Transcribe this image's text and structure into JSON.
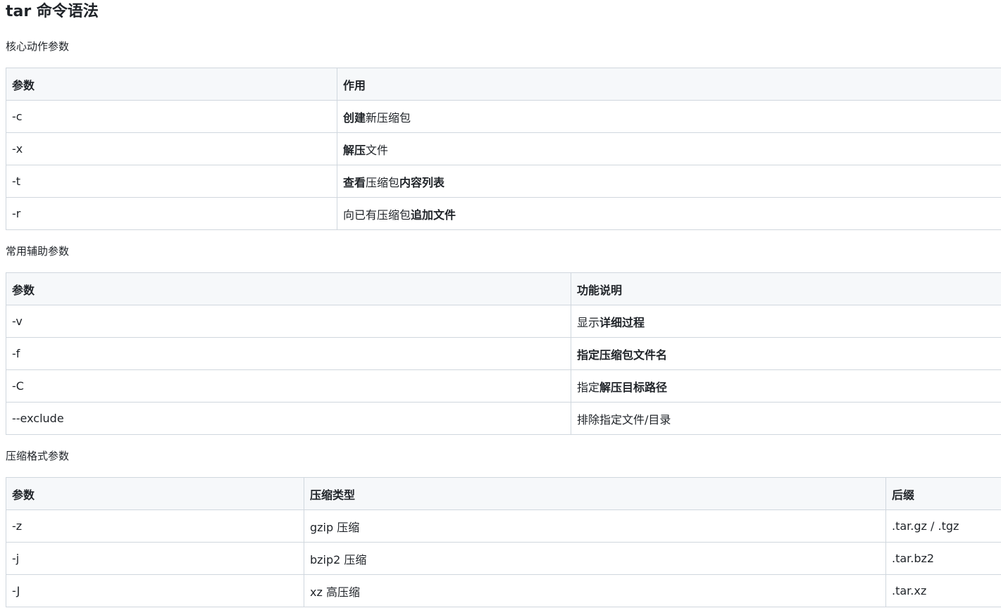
{
  "title": "tar 命令语法",
  "sections": [
    {
      "label": "核心动作参数",
      "headers": [
        "参数",
        "作用"
      ],
      "rows": [
        [
          [
            "-c"
          ],
          [
            {
              "b": true,
              "t": "创建"
            },
            {
              "t": "新压缩包"
            }
          ]
        ],
        [
          [
            "-x"
          ],
          [
            {
              "b": true,
              "t": "解压"
            },
            {
              "t": "文件"
            }
          ]
        ],
        [
          [
            "-t"
          ],
          [
            {
              "b": true,
              "t": "查看"
            },
            {
              "t": "压缩包"
            },
            {
              "b": true,
              "t": "内容列表"
            }
          ]
        ],
        [
          [
            "-r"
          ],
          [
            {
              "t": "向已有压缩包"
            },
            {
              "b": true,
              "t": "追加文件"
            }
          ]
        ]
      ]
    },
    {
      "label": "常用辅助参数",
      "headers": [
        "参数",
        "功能说明"
      ],
      "rows": [
        [
          [
            "-v"
          ],
          [
            {
              "t": "显示"
            },
            {
              "b": true,
              "t": "详细过程"
            }
          ]
        ],
        [
          [
            "-f"
          ],
          [
            {
              "b": true,
              "t": "指定压缩包文件名"
            }
          ]
        ],
        [
          [
            "-C"
          ],
          [
            {
              "t": "指定"
            },
            {
              "b": true,
              "t": "解压目标路径"
            }
          ]
        ],
        [
          [
            "--exclude"
          ],
          [
            {
              "t": "排除指定文件/目录"
            }
          ]
        ]
      ]
    },
    {
      "label": "压缩格式参数",
      "headers": [
        "参数",
        "压缩类型",
        "后缀"
      ],
      "rows": [
        [
          [
            "-z"
          ],
          [
            {
              "t": "gzip 压缩"
            }
          ],
          [
            {
              "t": ".tar.gz / .tgz"
            }
          ]
        ],
        [
          [
            "-j"
          ],
          [
            {
              "t": "bzip2 压缩"
            }
          ],
          [
            {
              "t": ".tar.bz2"
            }
          ]
        ],
        [
          [
            "-J"
          ],
          [
            {
              "t": "xz 高压缩"
            }
          ],
          [
            {
              "t": ".tar.xz"
            }
          ]
        ]
      ]
    }
  ]
}
